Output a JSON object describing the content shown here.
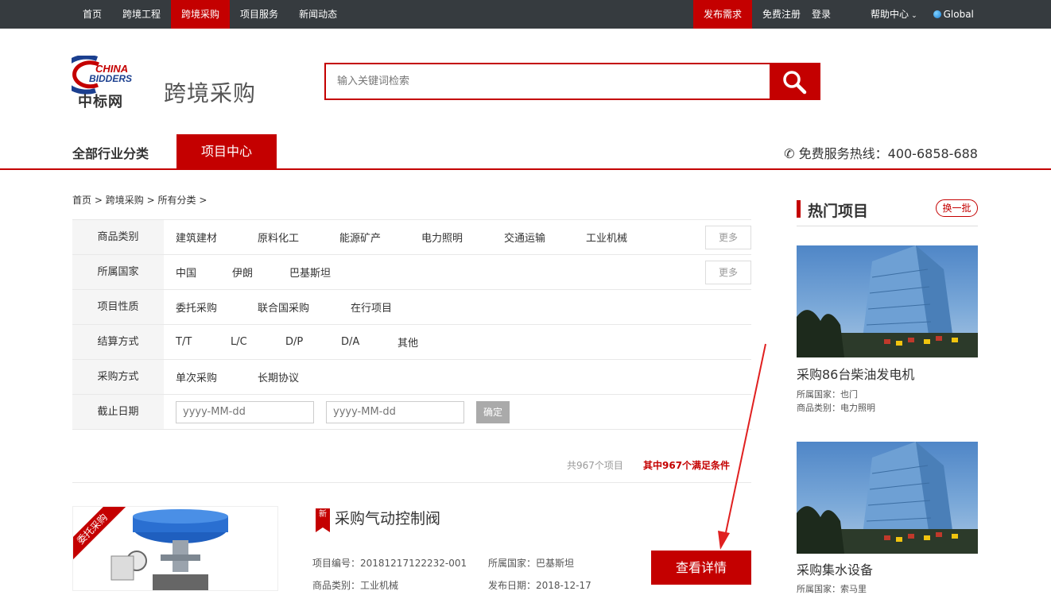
{
  "topnav": {
    "left": [
      "首页",
      "跨境工程",
      "跨境采购",
      "项目服务",
      "新闻动态"
    ],
    "active": "跨境采购",
    "publish": "发布需求",
    "register": "免费注册",
    "login": "登录",
    "help": "帮助中心",
    "global": "Global"
  },
  "header": {
    "logo_en_1": "CHINA",
    "logo_en_2": "BIDDERS",
    "logo_cn": "中标网",
    "site_title": "跨境采购",
    "search_placeholder": "输入关键词检索"
  },
  "catnav": {
    "all_categories": "全部行业分类",
    "project_center": "项目中心",
    "hotline": "免费服务热线：400-6858-688"
  },
  "breadcrumb": {
    "home": "首页",
    "section": "跨境采购",
    "all": "所有分类",
    "sep": ">"
  },
  "filters": {
    "more_label": "更多",
    "confirm_label": "确定",
    "date_placeholder": "yyyy-MM-dd",
    "rows": [
      {
        "label": "商品类别",
        "options": [
          "建筑建材",
          "原料化工",
          "能源矿产",
          "电力照明",
          "交通运输",
          "工业机械"
        ]
      },
      {
        "label": "所属国家",
        "options": [
          "中国",
          "伊朗",
          "巴基斯坦"
        ]
      },
      {
        "label": "项目性质",
        "options": [
          "委托采购",
          "联合国采购",
          "在行项目"
        ]
      },
      {
        "label": "结算方式",
        "options": [
          "T/T",
          "L/C",
          "D/P",
          "D/A",
          "其他"
        ]
      },
      {
        "label": "采购方式",
        "options": [
          "单次采购",
          "长期协议"
        ]
      },
      {
        "label": "截止日期"
      }
    ]
  },
  "results": {
    "total": "共967个项目",
    "matched": "其中967个满足条件"
  },
  "project": {
    "ribbon": "委托采购",
    "new_badge": "新",
    "title": "采购气动控制阀",
    "code": "项目编号：20181217122232-001",
    "country": "所属国家：巴基斯坦",
    "category": "商品类别：工业机械",
    "date": "发布日期：2018-12-17",
    "detail_button": "查看详情"
  },
  "sidebar": {
    "heading": "热门项目",
    "refresh": "换一批",
    "items": [
      {
        "title": "采购86台柴油发电机",
        "country": "所属国家：也门",
        "category": "商品类别：电力照明"
      },
      {
        "title": "采购集水设备",
        "country": "所属国家：索马里"
      }
    ]
  },
  "colors": {
    "accent": "#c40000",
    "topbar": "#363b3f"
  }
}
